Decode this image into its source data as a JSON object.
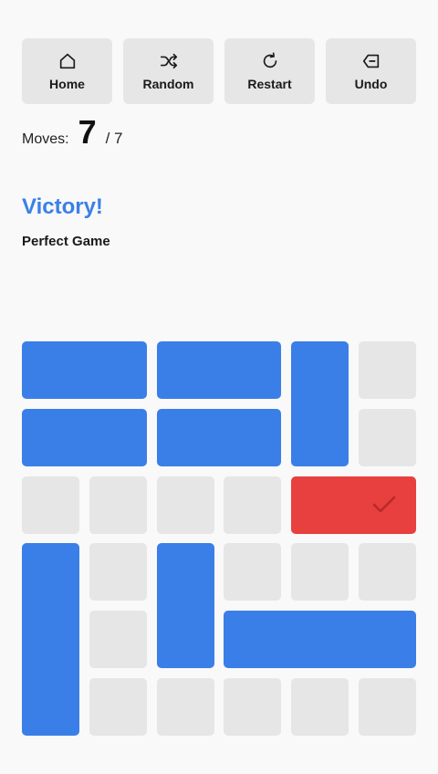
{
  "toolbar": {
    "home_label": "Home",
    "random_label": "Random",
    "restart_label": "Restart",
    "undo_label": "Undo"
  },
  "moves": {
    "label": "Moves:",
    "count": "7",
    "total": "/ 7"
  },
  "status": {
    "title": "Victory!",
    "subtitle": "Perfect Game"
  },
  "colors": {
    "block": "#3a7fe8",
    "target_block": "#e8403f",
    "empty_cell": "#e6e6e6",
    "accent_text": "#3a80e8"
  },
  "board": {
    "columns": 6,
    "rows": 6,
    "blocks": [
      {
        "id": "h1",
        "row": 0,
        "col": 0,
        "length": 2,
        "orientation": "horizontal",
        "target": false
      },
      {
        "id": "h2",
        "row": 0,
        "col": 2,
        "length": 2,
        "orientation": "horizontal",
        "target": false
      },
      {
        "id": "v1",
        "row": 0,
        "col": 4,
        "length": 2,
        "orientation": "vertical",
        "target": false
      },
      {
        "id": "h3",
        "row": 1,
        "col": 0,
        "length": 2,
        "orientation": "horizontal",
        "target": false
      },
      {
        "id": "h4",
        "row": 1,
        "col": 2,
        "length": 2,
        "orientation": "horizontal",
        "target": false
      },
      {
        "id": "target",
        "row": 2,
        "col": 4,
        "length": 2,
        "orientation": "horizontal",
        "target": true
      },
      {
        "id": "v2",
        "row": 3,
        "col": 0,
        "length": 3,
        "orientation": "vertical",
        "target": false
      },
      {
        "id": "v3",
        "row": 3,
        "col": 2,
        "length": 2,
        "orientation": "vertical",
        "target": false
      },
      {
        "id": "h5",
        "row": 4,
        "col": 3,
        "length": 3,
        "orientation": "horizontal",
        "target": false
      }
    ]
  }
}
